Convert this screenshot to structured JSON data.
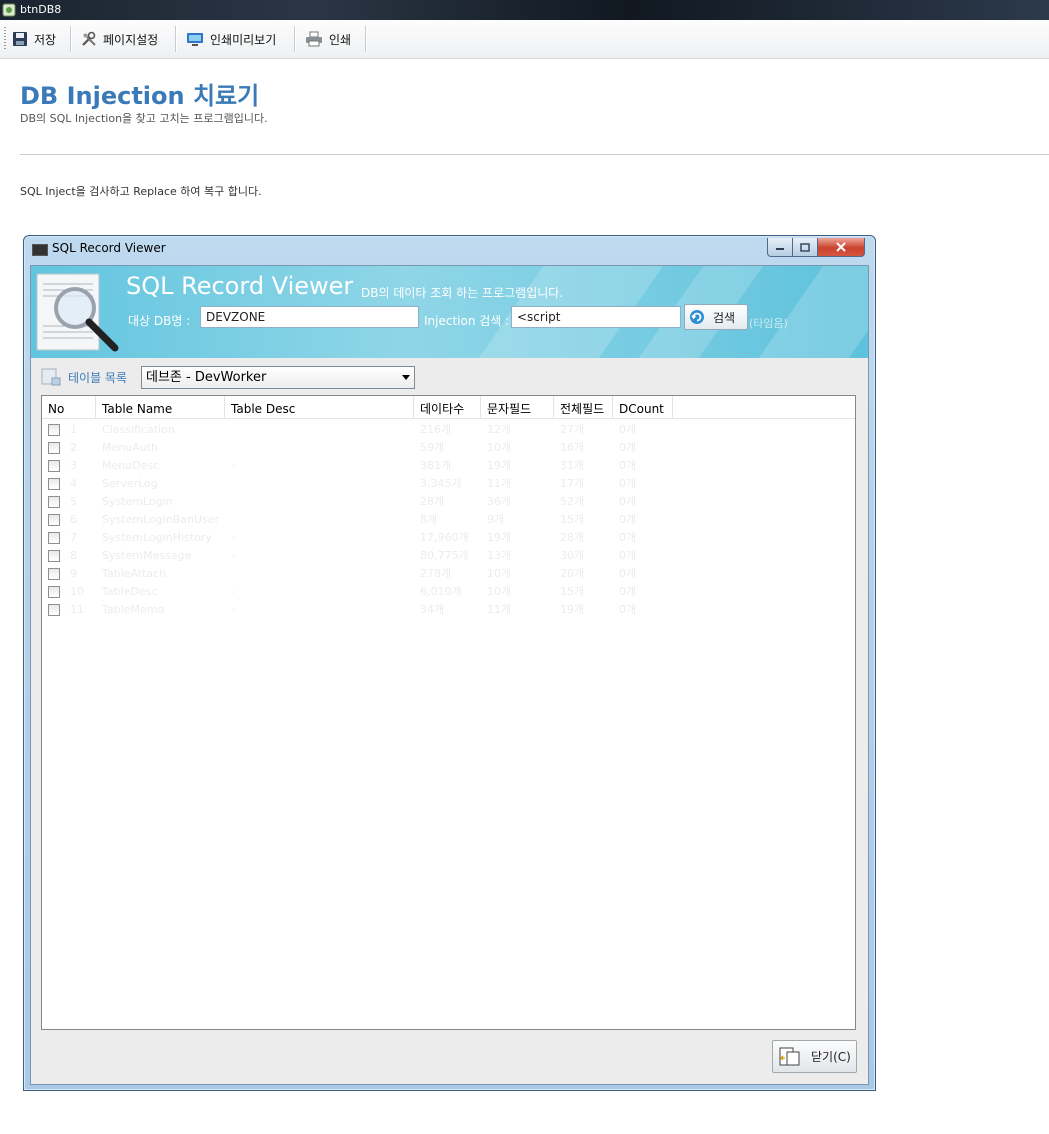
{
  "window": {
    "title": "btnDB8"
  },
  "toolbar": {
    "save": "저장",
    "page_setup": "페이지설정",
    "print_preview": "인쇄미리보기",
    "print": "인쇄"
  },
  "page": {
    "title": "DB Injection 치료기",
    "subtitle": "DB의 SQL Injection을 찾고 고치는 프로그램입니다.",
    "description": "SQL Inject을 검사하고 Replace 하여 복구 합니다."
  },
  "dialog": {
    "title": "SQL Record Viewer",
    "banner_title": "SQL Record Viewer",
    "banner_subtitle": "DB의 데이타 조회 하는 프로그램입니다.",
    "db_label": "대상 DB명 :",
    "db_value": "DEVZONE",
    "injection_label": "Injection 검색 :",
    "injection_value": "<script",
    "search_button": "검색",
    "search_hint": "(타임음)",
    "table_list_label": "테이블 목록",
    "table_select": "데브존 - DevWorker",
    "close_button": "닫기(C)",
    "columns": [
      "No",
      "Table Name",
      "Table Desc",
      "데이타수",
      "문자필드",
      "전체필드",
      "DCount"
    ],
    "rows": [
      {
        "no": "1",
        "name": "Classification",
        "desc": "",
        "count": "216개",
        "char": "12개",
        "total": "27개",
        "dcount": "0개"
      },
      {
        "no": "2",
        "name": "MenuAuth",
        "desc": "",
        "count": "59개",
        "char": "10개",
        "total": "16개",
        "dcount": "0개"
      },
      {
        "no": "3",
        "name": "MenuDesc",
        "desc": "-",
        "count": "381개",
        "char": "19개",
        "total": "31개",
        "dcount": "0개"
      },
      {
        "no": "4",
        "name": "ServerLog",
        "desc": "",
        "count": "3,345개",
        "char": "11개",
        "total": "17개",
        "dcount": "0개"
      },
      {
        "no": "5",
        "name": "SystemLogin",
        "desc": "",
        "count": "28개",
        "char": "36개",
        "total": "52개",
        "dcount": "0개"
      },
      {
        "no": "6",
        "name": "SystemLoginBanUser",
        "desc": "",
        "count": "8개",
        "char": "9개",
        "total": "15개",
        "dcount": "0개"
      },
      {
        "no": "7",
        "name": "SystemLoginHistory",
        "desc": "-",
        "count": "17,960개",
        "char": "19개",
        "total": "28개",
        "dcount": "0개"
      },
      {
        "no": "8",
        "name": "SystemMessage",
        "desc": "-",
        "count": "80,775개",
        "char": "13개",
        "total": "30개",
        "dcount": "0개"
      },
      {
        "no": "9",
        "name": "TableAttach",
        "desc": "",
        "count": "278개",
        "char": "10개",
        "total": "20개",
        "dcount": "0개"
      },
      {
        "no": "10",
        "name": "TableDesc",
        "desc": "-",
        "count": "6,010개",
        "char": "10개",
        "total": "15개",
        "dcount": "0개"
      },
      {
        "no": "11",
        "name": "TableMemo",
        "desc": "-",
        "count": "34개",
        "char": "11개",
        "total": "19개",
        "dcount": "0개"
      }
    ]
  },
  "colors": {
    "accent": "#3a7ab8",
    "banner": "#62c5df",
    "frame": "#a9c9e6",
    "close": "#c9432e"
  }
}
